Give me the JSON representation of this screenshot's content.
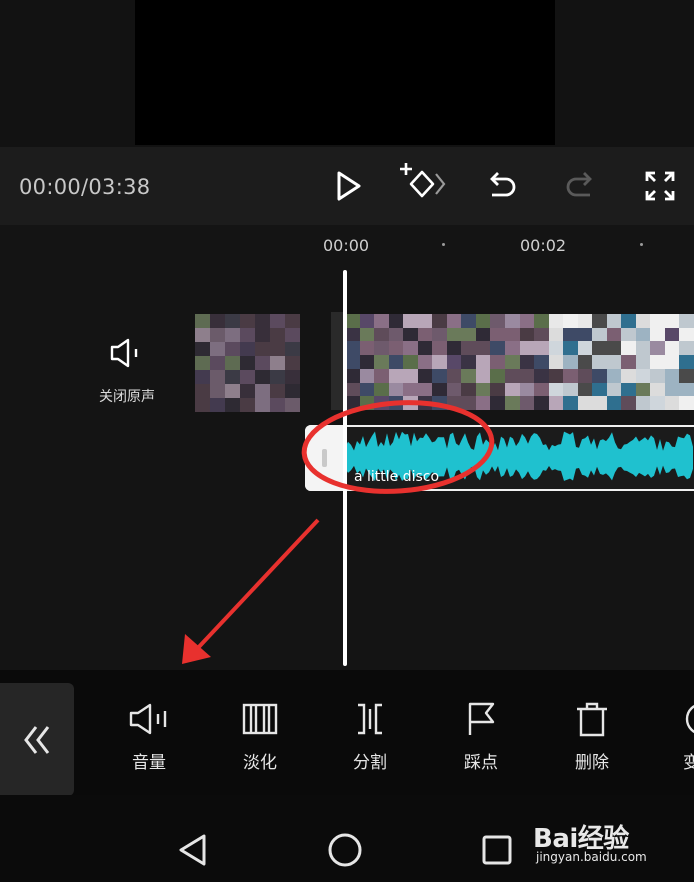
{
  "player": {
    "time": "00:00/03:38",
    "icons": [
      "play-icon",
      "add-keyframe-icon",
      "undo-icon",
      "redo-icon",
      "fullscreen-icon"
    ]
  },
  "timeline": {
    "ruler": [
      "00:00",
      "00:02"
    ],
    "mute_label": "关闭原声",
    "audio_clip_title": "a little disco",
    "waveform_color": "#1fc1cf"
  },
  "toolbar": {
    "items": [
      {
        "label": "音量",
        "icon": "volume-icon"
      },
      {
        "label": "淡化",
        "icon": "fade-icon"
      },
      {
        "label": "分割",
        "icon": "split-icon"
      },
      {
        "label": "踩点",
        "icon": "flag-icon"
      },
      {
        "label": "删除",
        "icon": "delete-icon"
      },
      {
        "label": "变",
        "icon": "speed-icon"
      }
    ]
  },
  "annotations": {
    "color": "#e8312e"
  },
  "watermark": {
    "line1": "Bai经验",
    "line2": "jingyan.baidu.com"
  }
}
